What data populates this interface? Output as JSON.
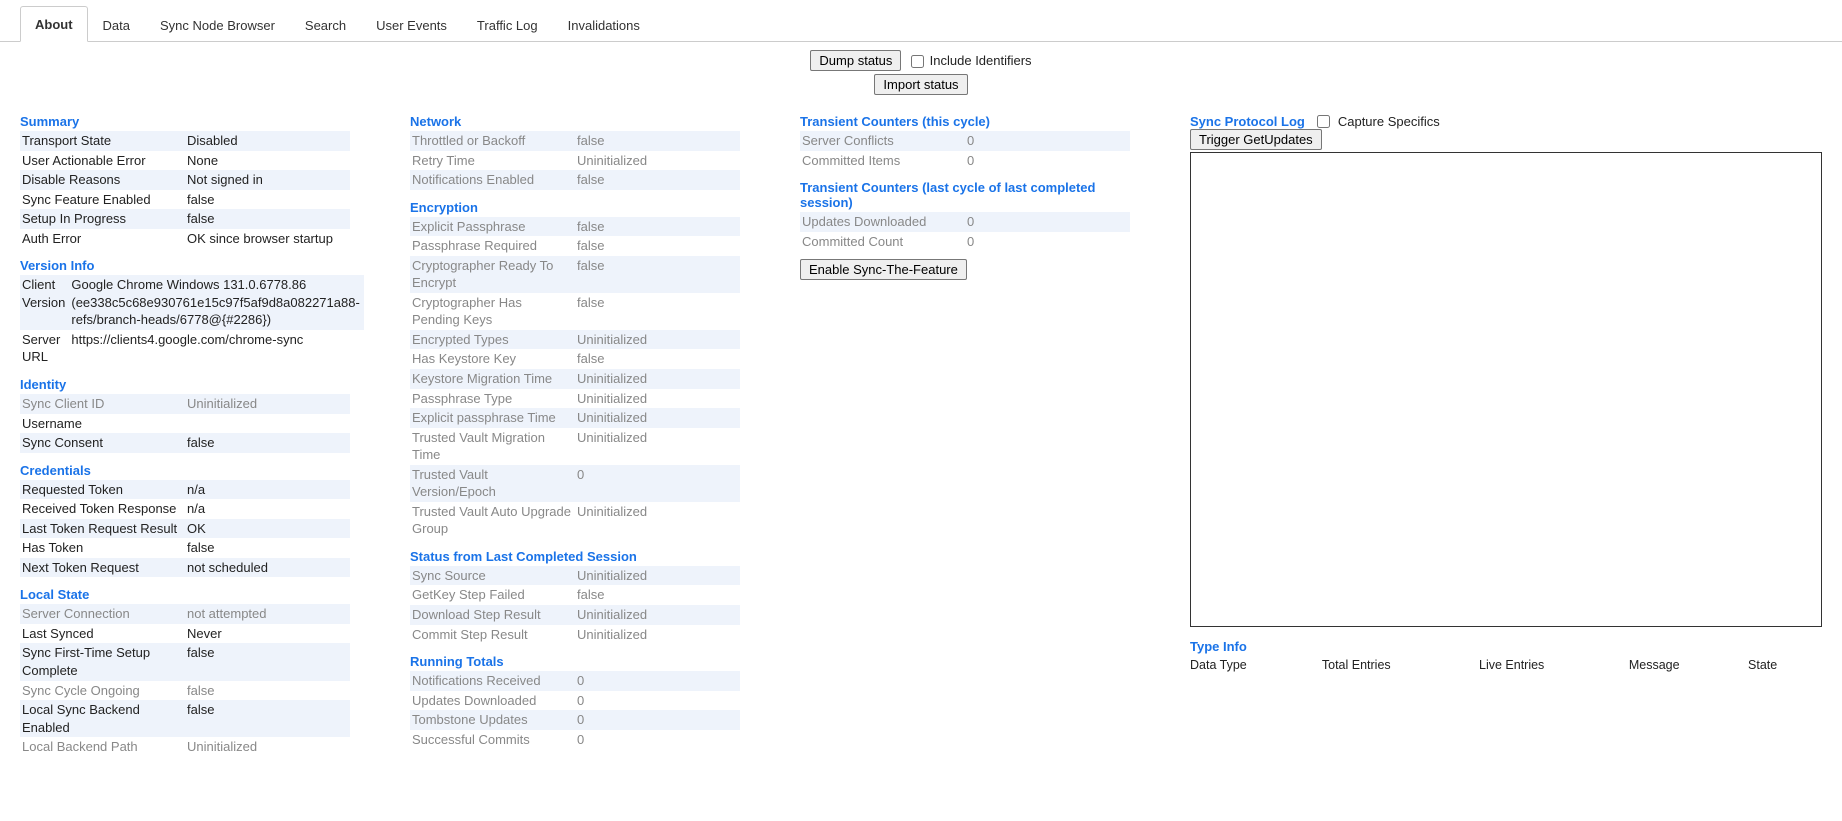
{
  "tabs": [
    "About",
    "Data",
    "Sync Node Browser",
    "Search",
    "User Events",
    "Traffic Log",
    "Invalidations"
  ],
  "active_tab": 0,
  "controls": {
    "dump_status": "Dump status",
    "include_identifiers": "Include Identifiers",
    "import_status": "Import status"
  },
  "col1": {
    "summary": {
      "title": "Summary",
      "rows": [
        {
          "k": "Transport State",
          "v": "Disabled",
          "disabled": false
        },
        {
          "k": "User Actionable Error",
          "v": "None",
          "disabled": false
        },
        {
          "k": "Disable Reasons",
          "v": "Not signed in",
          "disabled": false
        },
        {
          "k": "Sync Feature Enabled",
          "v": "false",
          "disabled": false
        },
        {
          "k": "Setup In Progress",
          "v": "false",
          "disabled": false
        },
        {
          "k": "Auth Error",
          "v": "OK since browser startup",
          "disabled": false
        }
      ]
    },
    "version": {
      "title": "Version Info",
      "rows": [
        {
          "k": "Client Version",
          "v": "Google Chrome Windows 131.0.6778.86 (ee338c5c68e930761e15c97f5af9d8a082271a88-refs/branch-heads/6778@{#2286})",
          "disabled": false
        },
        {
          "k": "Server URL",
          "v": "https://clients4.google.com/chrome-sync",
          "disabled": false
        }
      ]
    },
    "identity": {
      "title": "Identity",
      "rows": [
        {
          "k": "Sync Client ID",
          "v": "Uninitialized",
          "disabled": true
        },
        {
          "k": "Username",
          "v": "",
          "disabled": false
        },
        {
          "k": "Sync Consent",
          "v": "false",
          "disabled": false
        }
      ]
    },
    "credentials": {
      "title": "Credentials",
      "rows": [
        {
          "k": "Requested Token",
          "v": "n/a",
          "disabled": false
        },
        {
          "k": "Received Token Response",
          "v": "n/a",
          "disabled": false
        },
        {
          "k": "Last Token Request Result",
          "v": "OK",
          "disabled": false
        },
        {
          "k": "Has Token",
          "v": "false",
          "disabled": false
        },
        {
          "k": "Next Token Request",
          "v": "not scheduled",
          "disabled": false
        }
      ]
    },
    "local_state": {
      "title": "Local State",
      "rows": [
        {
          "k": "Server Connection",
          "v": "not attempted",
          "disabled": true
        },
        {
          "k": "Last Synced",
          "v": "Never",
          "disabled": false
        },
        {
          "k": "Sync First-Time Setup Complete",
          "v": "false",
          "disabled": false
        },
        {
          "k": "Sync Cycle Ongoing",
          "v": "false",
          "disabled": true
        },
        {
          "k": "Local Sync Backend Enabled",
          "v": "false",
          "disabled": false
        },
        {
          "k": "Local Backend Path",
          "v": "Uninitialized",
          "disabled": true
        }
      ]
    }
  },
  "col2": {
    "network": {
      "title": "Network",
      "rows": [
        {
          "k": "Throttled or Backoff",
          "v": "false",
          "disabled": true
        },
        {
          "k": "Retry Time",
          "v": "Uninitialized",
          "disabled": true
        },
        {
          "k": "Notifications Enabled",
          "v": "false",
          "disabled": true
        }
      ]
    },
    "encryption": {
      "title": "Encryption",
      "rows": [
        {
          "k": "Explicit Passphrase",
          "v": "false",
          "disabled": true
        },
        {
          "k": "Passphrase Required",
          "v": "false",
          "disabled": true
        },
        {
          "k": "Cryptographer Ready To Encrypt",
          "v": "false",
          "disabled": true
        },
        {
          "k": "Cryptographer Has Pending Keys",
          "v": "false",
          "disabled": true
        },
        {
          "k": "Encrypted Types",
          "v": "Uninitialized",
          "disabled": true
        },
        {
          "k": "Has Keystore Key",
          "v": "false",
          "disabled": true
        },
        {
          "k": "Keystore Migration Time",
          "v": "Uninitialized",
          "disabled": true
        },
        {
          "k": "Passphrase Type",
          "v": "Uninitialized",
          "disabled": true
        },
        {
          "k": "Explicit passphrase Time",
          "v": "Uninitialized",
          "disabled": true
        },
        {
          "k": "Trusted Vault Migration Time",
          "v": "Uninitialized",
          "disabled": true
        },
        {
          "k": "Trusted Vault Version/Epoch",
          "v": "0",
          "disabled": true
        },
        {
          "k": "Trusted Vault Auto Upgrade Group",
          "v": "Uninitialized",
          "disabled": true
        }
      ]
    },
    "last_session": {
      "title": "Status from Last Completed Session",
      "rows": [
        {
          "k": "Sync Source",
          "v": "Uninitialized",
          "disabled": true
        },
        {
          "k": "GetKey Step Failed",
          "v": "false",
          "disabled": true
        },
        {
          "k": "Download Step Result",
          "v": "Uninitialized",
          "disabled": true
        },
        {
          "k": "Commit Step Result",
          "v": "Uninitialized",
          "disabled": true
        }
      ]
    },
    "running_totals": {
      "title": "Running Totals",
      "rows": [
        {
          "k": "Notifications Received",
          "v": "0",
          "disabled": true
        },
        {
          "k": "Updates Downloaded",
          "v": "0",
          "disabled": true
        },
        {
          "k": "Tombstone Updates",
          "v": "0",
          "disabled": true
        },
        {
          "k": "Successful Commits",
          "v": "0",
          "disabled": true
        }
      ]
    }
  },
  "col3": {
    "this_cycle": {
      "title": "Transient Counters (this cycle)",
      "rows": [
        {
          "k": "Server Conflicts",
          "v": "0",
          "disabled": true
        },
        {
          "k": "Committed Items",
          "v": "0",
          "disabled": true
        }
      ]
    },
    "last_cycle": {
      "title": "Transient Counters (last cycle of last completed session)",
      "rows": [
        {
          "k": "Updates Downloaded",
          "v": "0",
          "disabled": true
        },
        {
          "k": "Committed Count",
          "v": "0",
          "disabled": true
        }
      ]
    },
    "enable_button": "Enable Sync-The-Feature"
  },
  "col4": {
    "protocol_log_title": "Sync Protocol Log",
    "capture_specifics": "Capture Specifics",
    "trigger_button": "Trigger GetUpdates",
    "type_info_title": "Type Info",
    "type_info_headers": [
      "Data Type",
      "Total Entries",
      "Live Entries",
      "Message",
      "State"
    ]
  }
}
